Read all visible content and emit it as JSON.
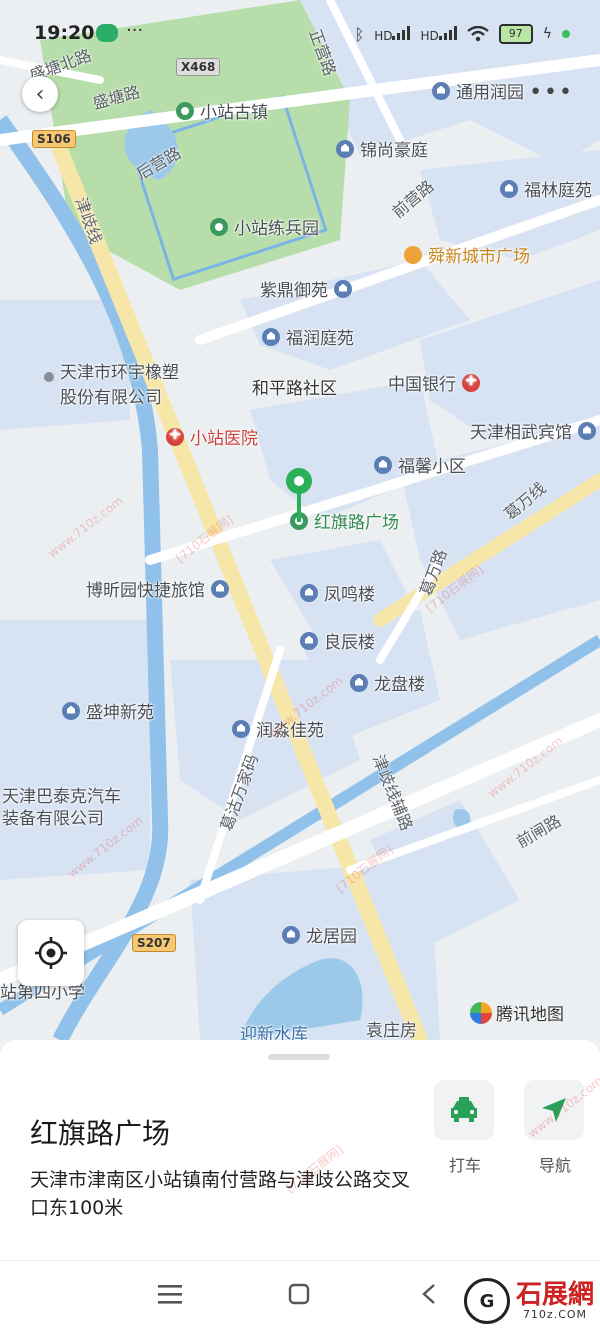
{
  "status_bar": {
    "time": "19:20",
    "battery": "97",
    "notification_dots": "···",
    "signal_label": "HD"
  },
  "map": {
    "labels": {
      "pois": [
        {
          "name": "小站古镇",
          "kind": "green"
        },
        {
          "name": "通用润园",
          "kind": "blue"
        },
        {
          "name": "锦尚豪庭",
          "kind": "blue"
        },
        {
          "name": "福林庭苑",
          "kind": "blue"
        },
        {
          "name": "小站练兵园",
          "kind": "green"
        },
        {
          "name": "舜新城市广场",
          "kind": "orange"
        },
        {
          "name": "紫鼎御苑",
          "kind": "blue"
        },
        {
          "name": "福润庭苑",
          "kind": "blue"
        },
        {
          "name": "中国银行",
          "kind": "red"
        },
        {
          "name": "天津相武宾馆",
          "kind": "blue"
        },
        {
          "name": "小站医院",
          "kind": "red"
        },
        {
          "name": "福馨小区",
          "kind": "blue"
        },
        {
          "name": "红旗路广场",
          "kind": "green"
        },
        {
          "name": "博昕园快捷旅馆",
          "kind": "blue"
        },
        {
          "name": "凤鸣楼",
          "kind": "blue"
        },
        {
          "name": "良辰楼",
          "kind": "blue"
        },
        {
          "name": "龙盘楼",
          "kind": "blue"
        },
        {
          "name": "盛坤新苑",
          "kind": "blue"
        },
        {
          "name": "润淼佳苑",
          "kind": "blue"
        },
        {
          "name": "龙居园",
          "kind": "blue"
        }
      ],
      "areas": [
        "和平路社区",
        "天津市环宇橡塑",
        "股份有限公司",
        "天津巴泰克汽车",
        "装备有限公司",
        "站第四小学",
        "迎新水库",
        "袁庄房"
      ],
      "roads": [
        "盛塘北路",
        "盛塘路",
        "后营路",
        "正营路",
        "前营路",
        "津歧线",
        "葛万线",
        "葛万路",
        "葛沽万家码",
        "津歧线辅路",
        "前闸路"
      ],
      "shields": [
        "X468",
        "S106",
        "S207"
      ]
    },
    "provider": "腾讯地图"
  },
  "place": {
    "title": "红旗路广场",
    "address": "天津市津南区小站镇南付营路与津歧公路交叉口东100米"
  },
  "actions": {
    "taxi_label": "打车",
    "navigate_label": "导航"
  },
  "watermark": {
    "text_cn": "[710石展网]",
    "text_url": "www.710z.com",
    "brand": "石展網",
    "brand_url": "710z.COM",
    "brand_mark": "G"
  },
  "icons": [
    "back-arrow-icon",
    "more-dots-icon",
    "locate-icon",
    "map-pin-icon",
    "taxi-icon",
    "navigate-arrow-icon",
    "menu-icon",
    "home-square-icon",
    "back-chevron-icon",
    "wechat-icon",
    "bluetooth-icon",
    "wifi-icon",
    "battery-icon"
  ]
}
